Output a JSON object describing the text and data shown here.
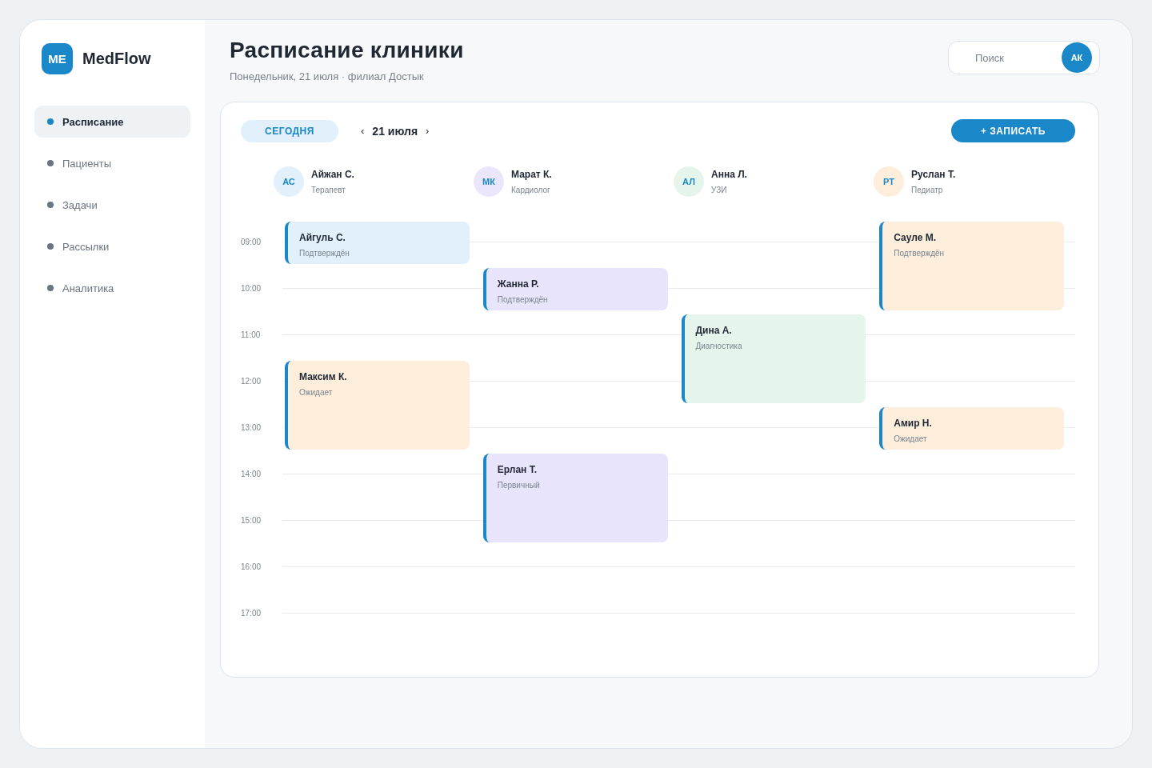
{
  "sidebar": {
    "logo": {
      "initials": "ME",
      "name": "MedFlow"
    },
    "items": [
      {
        "label": "Расписание",
        "selected": true
      },
      {
        "label": "Пациенты",
        "selected": false
      },
      {
        "label": "Задачи",
        "selected": false
      },
      {
        "label": "Рассылки",
        "selected": false
      },
      {
        "label": "Аналитика",
        "selected": false
      }
    ]
  },
  "header": {
    "title": "Расписание клиники",
    "subtitle": "Понедельник, 21 июля · филиал Достык",
    "search": {
      "placeholder": "Поиск"
    },
    "user": {
      "initials": "АК"
    }
  },
  "toolbar": {
    "today": "СЕГОДНЯ",
    "prev": "‹",
    "date": "21 июля",
    "next": "›",
    "add": "+ ЗАПИСАТЬ"
  },
  "doctors": [
    {
      "initials": "АС",
      "name": "Айжан С.",
      "role": "Терапевт",
      "color": "#e1f0fb"
    },
    {
      "initials": "МК",
      "name": "Марат К.",
      "role": "Кардиолог",
      "color": "#ebe6fb"
    },
    {
      "initials": "АЛ",
      "name": "Анна Л.",
      "role": "УЗИ",
      "color": "#e6f5ec"
    },
    {
      "initials": "РТ",
      "name": "Руслан Т.",
      "role": "Педиатр",
      "color": "#fdeedb"
    }
  ],
  "schedule": [
    {
      "time": "09:00",
      "cells": [
        {
          "patient": "Айгуль С.",
          "status": "Подтверждён",
          "kind": "short",
          "color": "#e1f0fb"
        },
        null,
        null,
        {
          "patient": "Сауле М.",
          "status": "Подтверждён",
          "kind": "long",
          "color": "#fdeedb"
        }
      ]
    },
    {
      "time": "10:00",
      "cells": [
        null,
        {
          "patient": "Жанна Р.",
          "status": "Подтверждён",
          "kind": "short",
          "color": "#e8e4fb"
        },
        null,
        null
      ]
    },
    {
      "time": "11:00",
      "cells": [
        null,
        null,
        {
          "patient": "Дина А.",
          "status": "Диагностика",
          "kind": "long",
          "color": "#e6f5ec"
        },
        null
      ]
    },
    {
      "time": "12:00",
      "cells": [
        {
          "patient": "Максим К.",
          "status": "Ожидает",
          "kind": "long",
          "color": "#fdeedb"
        },
        null,
        null,
        null
      ]
    },
    {
      "time": "13:00",
      "cells": [
        null,
        null,
        null,
        {
          "patient": "Амир Н.",
          "status": "Ожидает",
          "kind": "short",
          "color": "#fdeedb"
        }
      ]
    },
    {
      "time": "14:00",
      "cells": [
        null,
        {
          "patient": "Ерлан Т.",
          "status": "Первичный",
          "kind": "long",
          "color": "#e8e4fb"
        },
        null,
        null
      ]
    },
    {
      "time": "15:00",
      "cells": [
        null,
        null,
        null,
        null
      ]
    },
    {
      "time": "16:00",
      "cells": [
        null,
        null,
        null,
        null
      ]
    },
    {
      "time": "17:00",
      "cells": [
        null,
        null,
        null,
        null
      ]
    }
  ]
}
